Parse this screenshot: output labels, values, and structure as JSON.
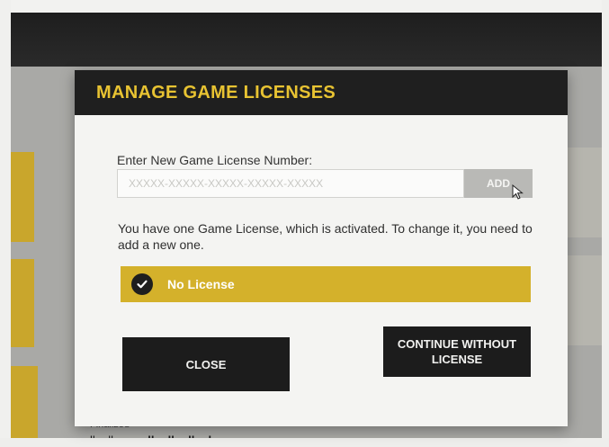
{
  "modal": {
    "title": "MANAGE GAME LICENSES",
    "input_label": "Enter New Game License Number:",
    "input_placeholder": "XXXXX-XXXXX-XXXXX-XXXXX-XXXXX",
    "input_value": "",
    "add_label": "ADD",
    "info_text": "You have one Game License, which is activated. To change it, you need to add a new one.",
    "license_item": {
      "label": "No License",
      "selected": true
    },
    "close_label": "CLOSE",
    "continue_label": "CONTINUE WITHOUT LICENSE"
  },
  "background": {
    "footer_line1": "Finalized",
    "footer_vs_left": "lkmlkm",
    "footer_vs": " vs. ",
    "footer_vs_right": "lkmlkmlkml"
  },
  "colors": {
    "accent_yellow": "#d4b12b",
    "title_yellow": "#e8c332",
    "dark": "#1c1c1c",
    "add_button_gray": "#b9b9b6"
  }
}
